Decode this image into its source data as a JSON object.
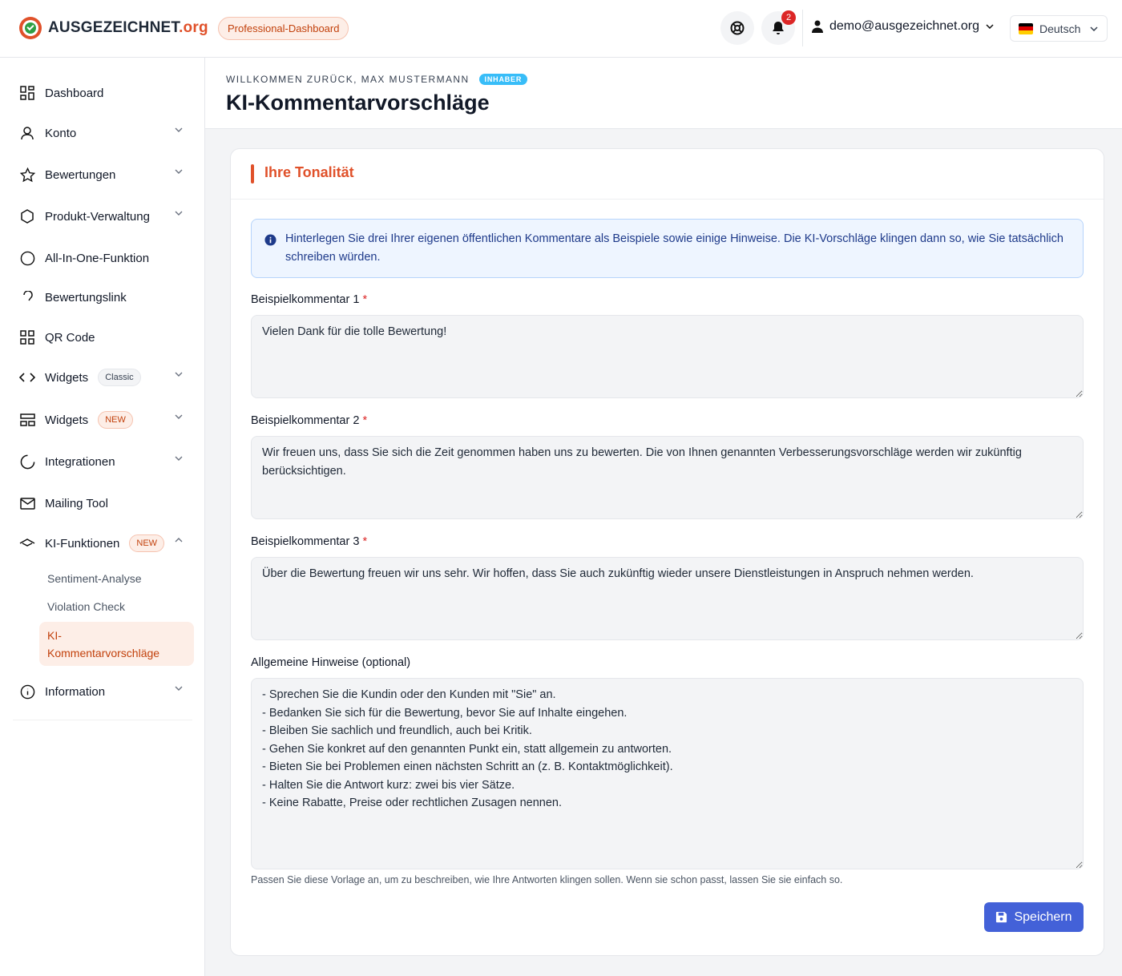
{
  "header": {
    "logo_main": "AUSGEZEICHNET",
    "logo_suffix": ".org",
    "dashboard_badge": "Professional-Dashboard",
    "notification_count": "2",
    "user_email": "demo@ausgezeichnet.org",
    "language": "Deutsch"
  },
  "sidebar": {
    "items": [
      {
        "label": "Dashboard",
        "icon": "dashboard-icon"
      },
      {
        "label": "Konto",
        "icon": "user-icon"
      },
      {
        "label": "Bewertungen",
        "icon": "star-icon"
      },
      {
        "label": "Produkt-Verwaltung",
        "icon": "hexagon-icon"
      },
      {
        "label": "All-In-One-Funktion",
        "icon": "circle-icon"
      },
      {
        "label": "Bewertungslink",
        "icon": "link-icon"
      },
      {
        "label": "QR Code",
        "icon": "qr-code-icon"
      },
      {
        "label": "Widgets",
        "badge": "Classic",
        "icon": "code-icon"
      },
      {
        "label": "Widgets",
        "badge": "NEW",
        "icon": "widget-icon"
      },
      {
        "label": "Integrationen",
        "icon": "spinner-icon"
      },
      {
        "label": "Mailing Tool",
        "icon": "mail-icon"
      },
      {
        "label": "KI-Funktionen",
        "badge": "NEW",
        "icon": "ai-icon"
      },
      {
        "label": "Information",
        "icon": "info-icon"
      }
    ],
    "sub_items": [
      "Sentiment-Analyse",
      "Violation Check"
    ],
    "active_sub_line1": "KI-",
    "active_sub_line2": "Kommentarvorschläge"
  },
  "page": {
    "welcome": "WILLKOMMEN ZURÜCK, MAX MUSTERMANN",
    "role": "INHABER",
    "title": "KI-Kommentarvorschläge"
  },
  "card": {
    "title": "Ihre Tonalität",
    "info": "Hinterlegen Sie drei Ihrer eigenen öffentlichen Kommentare als Beispiele sowie einige Hinweise. Die KI-Vorschläge klingen dann so, wie Sie tatsächlich schreiben würden.",
    "fields": [
      {
        "label": "Beispielkommentar 1",
        "required": "*",
        "value": "Vielen Dank für die tolle Bewertung!"
      },
      {
        "label": "Beispielkommentar 2",
        "required": "*",
        "value": "Wir freuen uns, dass Sie sich die Zeit genommen haben uns zu bewerten. Die von Ihnen genannten Verbesserungsvorschläge werden wir zukünftig berücksichtigen."
      },
      {
        "label": "Beispielkommentar 3",
        "required": "*",
        "value": "Über die Bewertung freuen wir uns sehr. Wir hoffen, dass Sie auch zukünftig wieder unsere Dienstleistungen in Anspruch nehmen werden."
      }
    ],
    "general_label": "Allgemeine Hinweise (optional)",
    "general_value": "- Sprechen Sie die Kundin oder den Kunden mit \"Sie\" an.\n- Bedanken Sie sich für die Bewertung, bevor Sie auf Inhalte eingehen.\n- Bleiben Sie sachlich und freundlich, auch bei Kritik.\n- Gehen Sie konkret auf den genannten Punkt ein, statt allgemein zu antworten.\n- Bieten Sie bei Problemen einen nächsten Schritt an (z. B. Kontaktmöglichkeit).\n- Halten Sie die Antwort kurz: zwei bis vier Sätze.\n- Keine Rabatte, Preise oder rechtlichen Zusagen nennen.",
    "hint": "Passen Sie diese Vorlage an, um zu beschreiben, wie Ihre Antworten klingen sollen. Wenn sie schon passt, lassen Sie sie einfach so.",
    "save_label": "Speichern"
  },
  "colors": {
    "brand": "#e0512a",
    "primary_button": "#4361d8",
    "info_bg": "#eef5ff",
    "active_nav_bg": "#fdeee7"
  }
}
